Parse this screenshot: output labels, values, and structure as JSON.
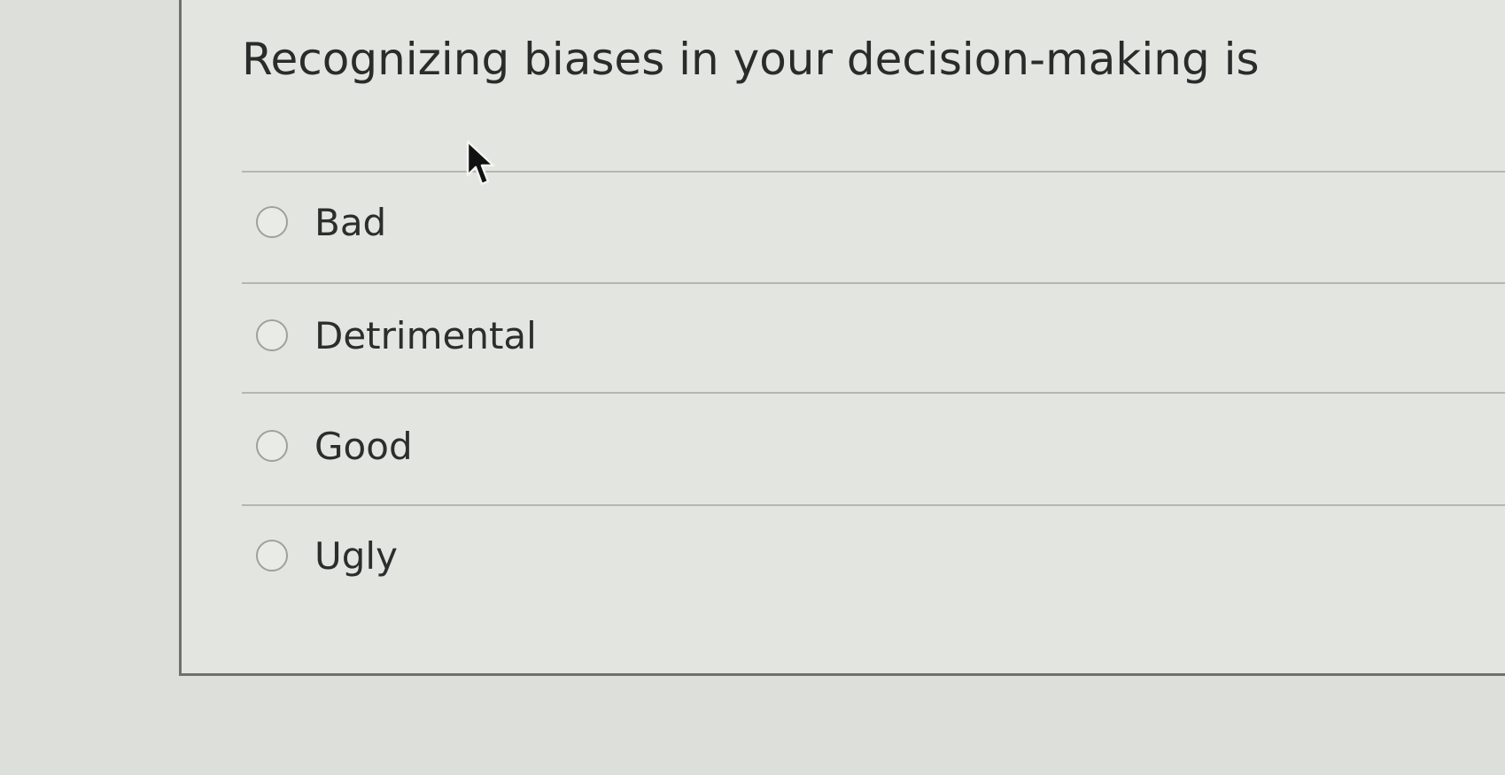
{
  "question": {
    "prompt": "Recognizing biases in your decision-making is",
    "options": [
      {
        "label": "Bad",
        "selected": false
      },
      {
        "label": "Detrimental",
        "selected": false
      },
      {
        "label": "Good",
        "selected": false
      },
      {
        "label": "Ugly",
        "selected": false
      }
    ]
  },
  "colors": {
    "background": "#dde0da",
    "card_border": "#6e716c",
    "text": "#2a2b2a",
    "divider": "#b3b6b1",
    "radio_border": "#9ea19c"
  },
  "icons": {
    "cursor": "mouse-pointer-icon",
    "radio": "radio-button-icon"
  }
}
